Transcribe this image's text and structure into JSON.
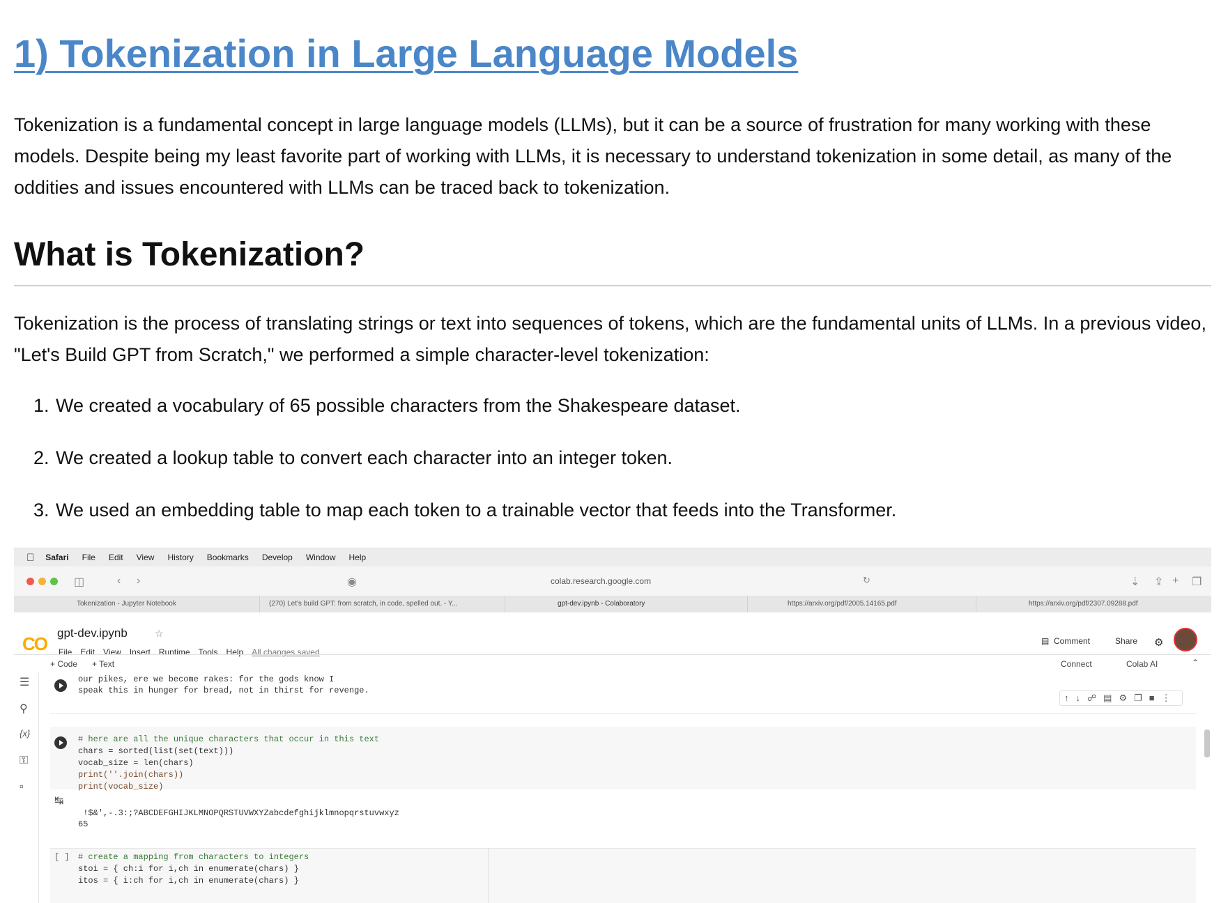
{
  "doc": {
    "title": "1) Tokenization in Large Language Models",
    "intro": "Tokenization is a fundamental concept in large language models (LLMs), but it can be a source of frustration for many working with these models. Despite being my least favorite part of working with LLMs, it is necessary to understand tokenization in some detail, as many of the oddities and issues encountered with LLMs can be traced back to tokenization.",
    "section_heading": "What is Tokenization?",
    "section_para": "Tokenization is the process of translating strings or text into sequences of tokens, which are the fundamental units of LLMs. In a previous video, \"Let's Build GPT from Scratch,\" we performed a simple character-level tokenization:",
    "list": [
      {
        "num": "1.",
        "text": "We created a vocabulary of 65 possible characters from the Shakespeare dataset."
      },
      {
        "num": "2.",
        "text": "We created a lookup table to convert each character into an integer token."
      },
      {
        "num": "3.",
        "text": "We used an embedding table to map each token to a trainable vector that feeds into the Transformer."
      }
    ]
  },
  "screenshot": {
    "menubar": [
      "Safari",
      "File",
      "Edit",
      "View",
      "History",
      "Bookmarks",
      "Develop",
      "Window",
      "Help"
    ],
    "url": "colab.research.google.com",
    "tabs": [
      "Tokenization - Jupyter Notebook",
      "(270) Let's build GPT: from scratch, in code, spelled out. - Y...",
      "gpt-dev.ipynb - Colaboratory",
      "https://arxiv.org/pdf/2005.14165.pdf",
      "https://arxiv.org/pdf/2307.09288.pdf"
    ],
    "colab": {
      "logo": "CO",
      "notebook_name": "gpt-dev.ipynb",
      "menu": [
        "File",
        "Edit",
        "View",
        "Insert",
        "Runtime",
        "Tools",
        "Help"
      ],
      "saved_status": "All changes saved",
      "comment": "Comment",
      "share": "Share",
      "add_code": "+ Code",
      "add_text": "+ Text",
      "connect": "Connect",
      "colab_ai": "Colab AI"
    },
    "cells": {
      "output1_line1": "our pikes, ere we become rakes: for the gods know I",
      "output1_line2": "speak this in hunger for bread, not in thirst for revenge.",
      "code2_comment": "# here are all the unique characters that occur in this text",
      "code2_line1": "chars = sorted(list(set(text)))",
      "code2_line2": "vocab_size = len(chars)",
      "code2_line3": "print(''.join(chars))",
      "code2_line4": "print(vocab_size)",
      "out2_line1": " !$&',-.3:;?ABCDEFGHIJKLMNOPQRSTUVWXYZabcdefghijklmnopqrstuvwxyz",
      "out2_line2": "65",
      "cell3_bracket": "[ ]",
      "code3_comment": "# create a mapping from characters to integers",
      "code3_line1": "stoi = { ch:i for i,ch in enumerate(chars) }",
      "code3_line2": "itos = { i:ch for i,ch in enumerate(chars) }"
    }
  }
}
